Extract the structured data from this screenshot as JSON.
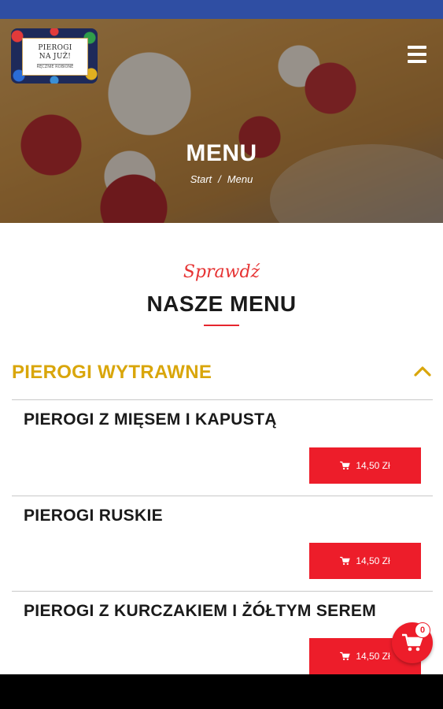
{
  "logo": {
    "line1": "PIEROGI",
    "line2": "NA JUŻ!",
    "line3": "RĘCZNIE ROBIONE"
  },
  "hero": {
    "title": "MENU",
    "breadcrumb": {
      "start": "Start",
      "separator": "/",
      "current": "Menu"
    }
  },
  "section": {
    "subtitle": "Sprawdź",
    "title": "NASZE MENU"
  },
  "category": {
    "title": "PIEROGI WYTRAWNE",
    "expanded": true
  },
  "items": [
    {
      "name": "PIEROGI Z MIĘSEM I KAPUSTĄ",
      "price": "14,50 Zł"
    },
    {
      "name": "PIEROGI RUSKIE",
      "price": "14,50 Zł"
    },
    {
      "name": "PIEROGI Z KURCZAKIEM I ŻÓŁTYM SEREM",
      "price": "14,50 Zł"
    }
  ],
  "cart": {
    "count": "0"
  },
  "colors": {
    "accent_red": "#ed1d2a",
    "category_gold": "#d9a60b",
    "status_bar": "#2f4ea3"
  },
  "icons": {
    "menu": "hamburger-icon",
    "chevron": "chevron-up-icon",
    "cart": "cart-icon"
  }
}
